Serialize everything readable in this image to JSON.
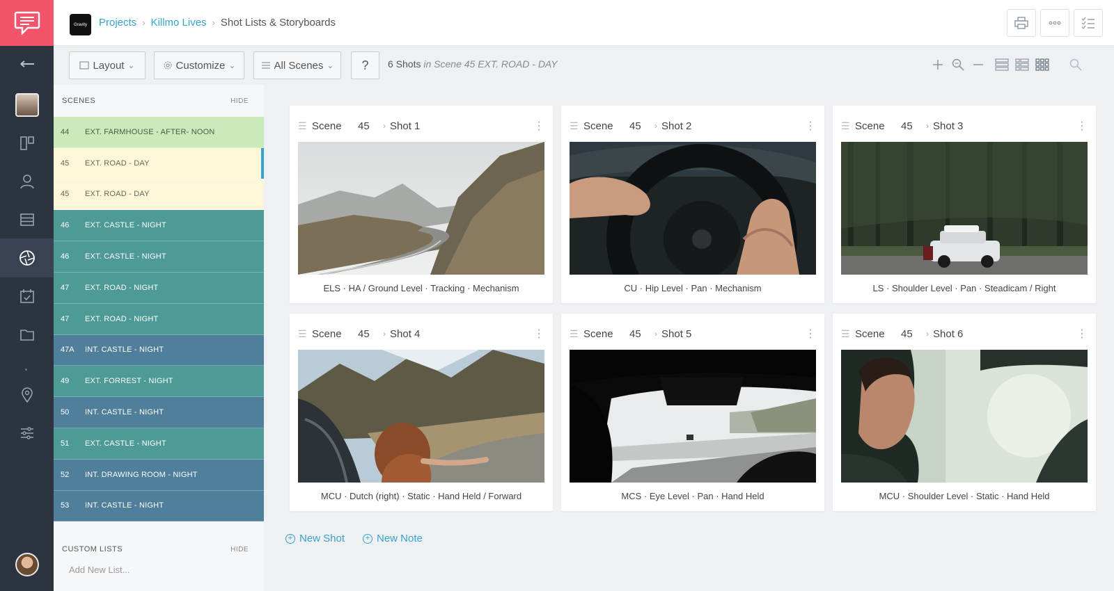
{
  "colors": {
    "rail": "#2c3440",
    "logo_bg": "#f2546a",
    "accent": "#36a3c9",
    "scene_green_light": "#c9ebbb",
    "scene_yellow": "#fcf7d9",
    "scene_teal": "#4e9a97",
    "scene_blue": "#4f7f9a"
  },
  "rail": {
    "logo_icon": "chat-bubble-icon",
    "items": [
      "back-arrow-icon",
      "avatar",
      "storyboard-icon",
      "people-icon",
      "stripboard-icon",
      "shot-list-icon",
      "calendar-icon",
      "folder-icon",
      "location-pin-icon",
      "sliders-icon",
      "user-avatar"
    ]
  },
  "header": {
    "brand_text": "Gravity",
    "breadcrumb": {
      "projects": "Projects",
      "project": "Killmo Lives",
      "current": "Shot Lists & Storyboards"
    },
    "buttons": [
      "print-icon",
      "more-icon",
      "checklist-icon"
    ]
  },
  "toolbar": {
    "layout": "Layout",
    "customize": "Customize",
    "all_scenes": "All Scenes",
    "help": "?",
    "count": "6 Shots",
    "count_context": "in Scene 45 EXT. ROAD - DAY"
  },
  "sidebar": {
    "scenes_title": "SCENES",
    "hide": "HIDE",
    "scenes": [
      {
        "num": "44",
        "name": "EXT. FARMHOUSE - AFTER- NOON",
        "color": "green_light"
      },
      {
        "num": "45",
        "name": "EXT. ROAD - DAY",
        "color": "yellow",
        "selected": true
      },
      {
        "num": "45",
        "name": "EXT. ROAD - DAY",
        "color": "yellow"
      },
      {
        "num": "46",
        "name": "EXT. CASTLE - NIGHT",
        "color": "teal"
      },
      {
        "num": "46",
        "name": "EXT. CASTLE - NIGHT",
        "color": "teal"
      },
      {
        "num": "47",
        "name": "EXT. ROAD - NIGHT",
        "color": "teal"
      },
      {
        "num": "47",
        "name": "EXT. ROAD - NIGHT",
        "color": "teal"
      },
      {
        "num": "47A",
        "name": "INT. CASTLE - NIGHT",
        "color": "blue"
      },
      {
        "num": "49",
        "name": "EXT. FORREST - NIGHT",
        "color": "teal"
      },
      {
        "num": "50",
        "name": "INT. CASTLE - NIGHT",
        "color": "blue"
      },
      {
        "num": "51",
        "name": "EXT. CASTLE - NIGHT",
        "color": "teal"
      },
      {
        "num": "52",
        "name": "INT. DRAWING ROOM - NIGHT",
        "color": "blue"
      },
      {
        "num": "53",
        "name": "INT. CASTLE - NIGHT",
        "color": "blue"
      }
    ],
    "custom_lists_title": "CUSTOM LISTS",
    "custom_hide": "HIDE",
    "add_list_placeholder": "Add New List..."
  },
  "shots": [
    {
      "scene_label": "Scene",
      "scene": "45",
      "shot": "Shot 1",
      "caption": "ELS · HA / Ground Level · Tracking · Mechanism",
      "image": "mountain-road"
    },
    {
      "scene_label": "Scene",
      "scene": "45",
      "shot": "Shot 2",
      "caption": "CU · Hip Level · Pan · Mechanism",
      "image": "steering-wheel"
    },
    {
      "scene_label": "Scene",
      "scene": "45",
      "shot": "Shot 3",
      "caption": "LS · Shoulder Level · Pan · Steadicam / Right",
      "image": "car-in-forest"
    },
    {
      "scene_label": "Scene",
      "scene": "45",
      "shot": "Shot 4",
      "caption": "MCU · Dutch (right) · Static · Hand Held / Forward",
      "image": "woman-car-window"
    },
    {
      "scene_label": "Scene",
      "scene": "45",
      "shot": "Shot 5",
      "caption": "MCS · Eye Level · Pan · Hand Held",
      "image": "highway-windshield"
    },
    {
      "scene_label": "Scene",
      "scene": "45",
      "shot": "Shot 6",
      "caption": "MCU · Shoulder Level · Static · Hand Held",
      "image": "driver-profile"
    }
  ],
  "actions": {
    "new_shot": "New Shot",
    "new_note": "New Note"
  }
}
